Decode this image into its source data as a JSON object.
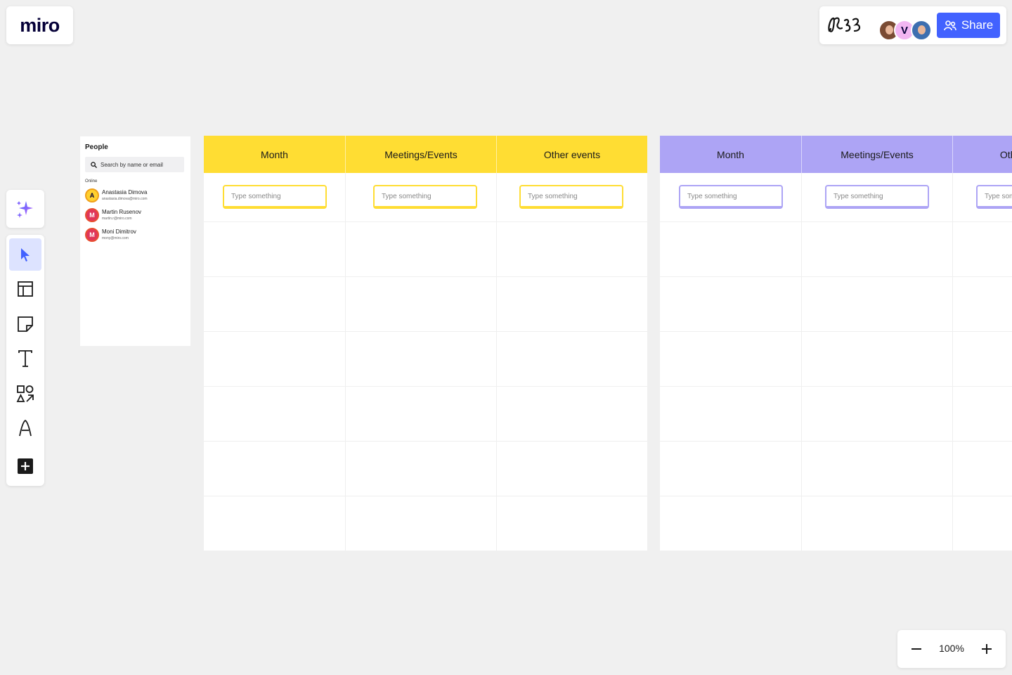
{
  "app": {
    "logo": "miro"
  },
  "topbar": {
    "avatars": [
      "user-photo-1",
      "V",
      "user-photo-2"
    ],
    "share_label": "Share"
  },
  "toolbar": {
    "tools": [
      "ai-sparkle",
      "select",
      "templates",
      "sticky-note",
      "text",
      "shapes",
      "pen",
      "add"
    ],
    "active": "select",
    "accent_color": "#4262ff"
  },
  "people_panel": {
    "title": "People",
    "search_placeholder": "Search by name or email",
    "online_label": "Online",
    "people": [
      {
        "initial": "A",
        "name": "Anastasia Dimova",
        "email": "anastasia.dimova@miro.com",
        "color": "#ffd02f"
      },
      {
        "initial": "M",
        "name": "Martin Rusenov",
        "email": "martin.r@miro.com",
        "color": "#e0365a"
      },
      {
        "initial": "M",
        "name": "Moni Dimitrov",
        "email": "mony@miro.com",
        "color": "#e0365a"
      }
    ]
  },
  "tables": [
    {
      "header_color": "#ffdd33",
      "columns": [
        "Month",
        "Meetings/Events",
        "Other events"
      ],
      "input_placeholder": "Type something"
    },
    {
      "header_color": "#ada4f5",
      "columns": [
        "Month",
        "Meetings/Events",
        "Other events"
      ],
      "input_placeholder": "Type something"
    }
  ],
  "zoom": {
    "level": "100%"
  }
}
